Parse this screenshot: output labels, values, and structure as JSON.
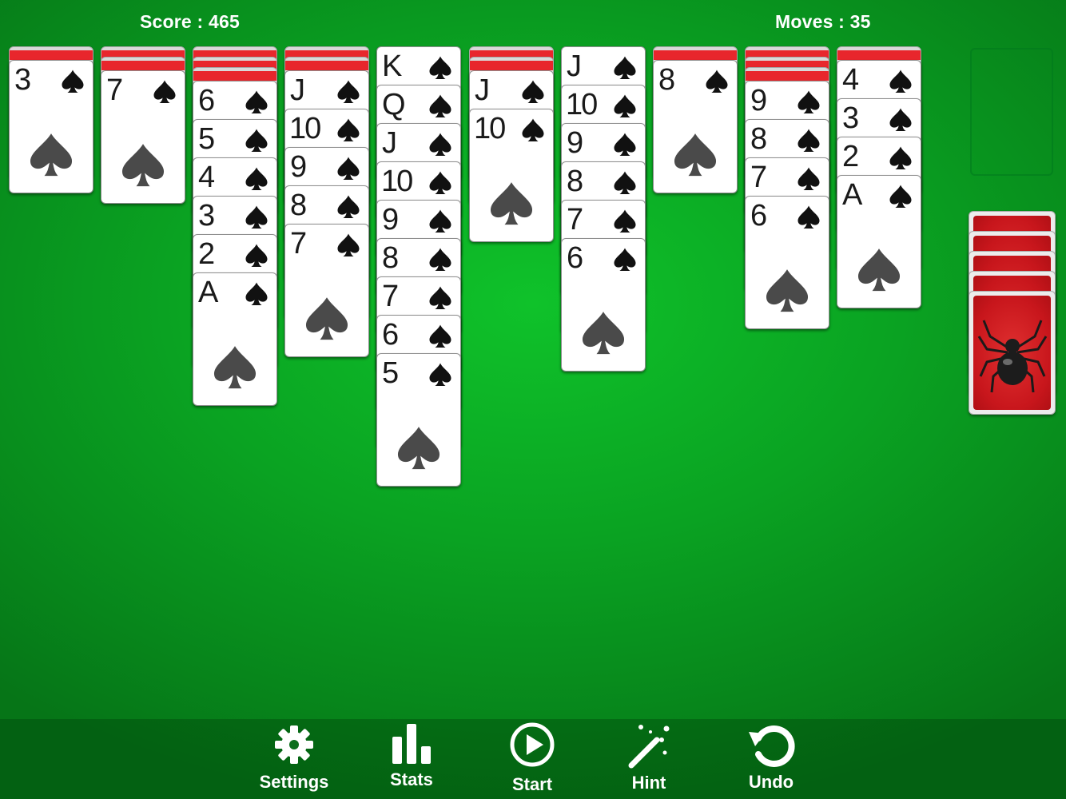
{
  "header": {
    "score_text": "Score : 465",
    "moves_text": "Moves : 35"
  },
  "colors": {
    "felt": "#0aa322",
    "card_back_red": "#e8262c",
    "ink": "#1a1a1a"
  },
  "tableau": [
    {
      "down": 1,
      "up": [
        "3"
      ]
    },
    {
      "down": 2,
      "up": [
        "7"
      ]
    },
    {
      "down": 3,
      "up": [
        "6",
        "5",
        "4",
        "3",
        "2",
        "A"
      ]
    },
    {
      "down": 2,
      "up": [
        "J",
        "10",
        "9",
        "8",
        "7"
      ]
    },
    {
      "down": 0,
      "up": [
        "K",
        "Q",
        "J",
        "10",
        "9",
        "8",
        "7",
        "6",
        "5"
      ]
    },
    {
      "down": 2,
      "up": [
        "J",
        "10"
      ]
    },
    {
      "down": 0,
      "up": [
        "J",
        "10",
        "9",
        "8",
        "7",
        "6"
      ]
    },
    {
      "down": 1,
      "up": [
        "8"
      ]
    },
    {
      "down": 3,
      "up": [
        "9",
        "8",
        "7",
        "6"
      ]
    },
    {
      "down": 1,
      "up": [
        "4",
        "3",
        "2",
        "A"
      ]
    }
  ],
  "suit_icon": "spade-icon",
  "stock_piles": 5,
  "toolbar": {
    "settings": {
      "label": "Settings",
      "icon": "gear-icon"
    },
    "stats": {
      "label": "Stats",
      "icon": "bar-chart-icon"
    },
    "start": {
      "label": "Start",
      "icon": "play-circle-icon"
    },
    "hint": {
      "label": "Hint",
      "icon": "magic-wand-icon"
    },
    "undo": {
      "label": "Undo",
      "icon": "undo-arrow-icon"
    }
  }
}
